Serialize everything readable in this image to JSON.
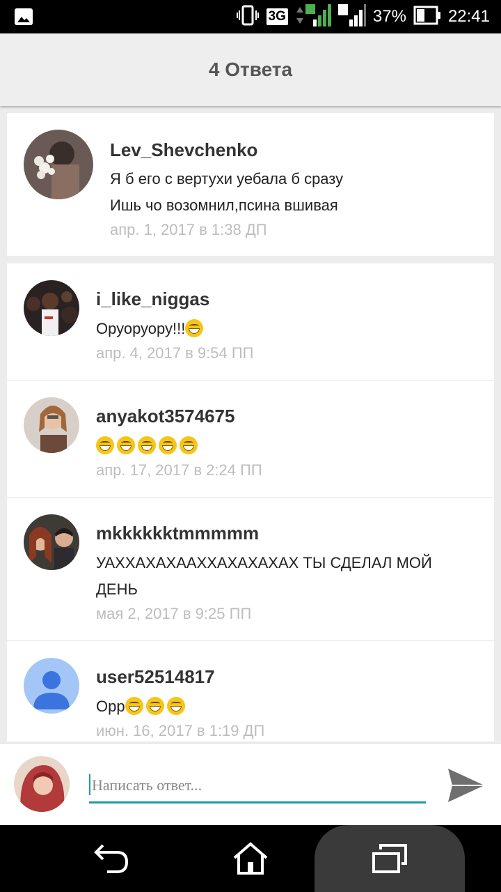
{
  "status_bar": {
    "network": "3G",
    "sim1": "1",
    "sim2": "2",
    "battery": "37%",
    "time": "22:41",
    "icons": [
      "gallery-icon",
      "vibrate-icon",
      "signal-icon",
      "battery-icon"
    ]
  },
  "header": {
    "title": "4 Ответа"
  },
  "main_comment": {
    "username": "Lev_Shevchenko",
    "lines": [
      "Я б его с вертухи уебала б сразу",
      "Ишь чо возомнил,псина вшивая"
    ],
    "date": "апр. 1, 2017 в 1:38 ДП"
  },
  "replies": [
    {
      "username": "i_like_niggas",
      "text": "Оруоруору!!!",
      "emoji_count": 1,
      "date": "апр. 4, 2017 в 9:54 ПП"
    },
    {
      "username": "anyakot3574675",
      "text": "",
      "emoji_count": 5,
      "date": "апр. 17, 2017 в 2:24 ПП"
    },
    {
      "username": "mkkkkkktmmmmm",
      "text": "УАХХАХАХААХХАХАХАХАХ ТЫ СДЕЛАЛ МОЙ",
      "text2": "ДЕНЬ",
      "emoji_count": 0,
      "date": "мая 2, 2017 в 9:25 ПП"
    },
    {
      "username": "user52514817",
      "text": "Орр",
      "emoji_count": 3,
      "date": "июн. 16, 2017 в 1:19 ДП"
    }
  ],
  "compose": {
    "placeholder": "Написать ответ..."
  },
  "colors": {
    "accent": "#1c9aa6",
    "date_gray": "#bdbdbd",
    "header_bg": "#eeeeee"
  }
}
